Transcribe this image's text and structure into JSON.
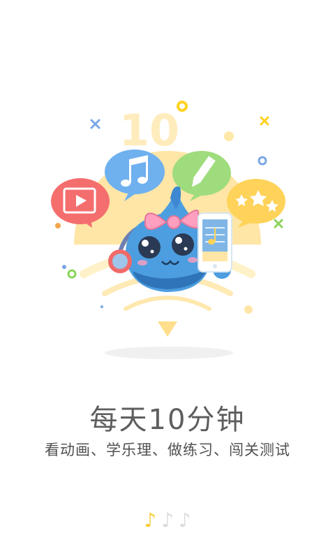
{
  "onboarding": {
    "badge": {
      "number": "10",
      "unit": "分钟"
    },
    "title": "每天10分钟",
    "subtitle": "看动画、学乐理、做练习、闯关测试",
    "pager": {
      "indicator_icon": "music-note-icon",
      "total": 3,
      "current": 1
    }
  },
  "colors": {
    "accent_yellow": "#ffe19a",
    "red_bubble": "#f56e6e",
    "blue_bubble": "#6fb0ef",
    "green_bubble": "#9fdc7d",
    "yellow_bubble": "#ffd35a"
  }
}
